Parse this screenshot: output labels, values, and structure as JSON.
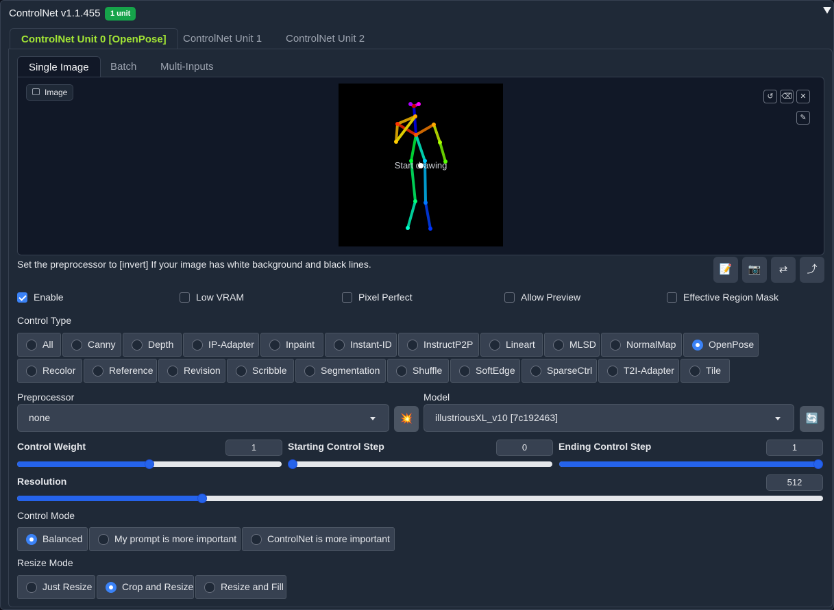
{
  "header": {
    "title": "ControlNet v1.1.455",
    "badge": "1 unit"
  },
  "unit_tabs": [
    "ControlNet Unit 0 [OpenPose]",
    "ControlNet Unit 1",
    "ControlNet Unit 2"
  ],
  "image_tabs": [
    "Single Image",
    "Batch",
    "Multi-Inputs"
  ],
  "canvas": {
    "image_label": "Image",
    "start_drawing": "Start drawing"
  },
  "hint": "Set the preprocessor to [invert] If your image has white background and black lines.",
  "action_buttons": {
    "edit": "📝",
    "camera": "📷",
    "swap": "⇄",
    "send": "⤴"
  },
  "checkboxes": [
    {
      "label": "Enable",
      "checked": true
    },
    {
      "label": "Low VRAM",
      "checked": false
    },
    {
      "label": "Pixel Perfect",
      "checked": false
    },
    {
      "label": "Allow Preview",
      "checked": false
    },
    {
      "label": "Effective Region Mask",
      "checked": false
    }
  ],
  "control_type": {
    "label": "Control Type",
    "row1": [
      "All",
      "Canny",
      "Depth",
      "IP-Adapter",
      "Inpaint",
      "Instant-ID",
      "InstructP2P",
      "Lineart",
      "MLSD",
      "NormalMap",
      "OpenPose"
    ],
    "row2": [
      "Recolor",
      "Reference",
      "Revision",
      "Scribble",
      "Segmentation",
      "Shuffle",
      "SoftEdge",
      "SparseCtrl",
      "T2I-Adapter",
      "Tile"
    ],
    "selected": "OpenPose"
  },
  "preprocessor": {
    "label": "Preprocessor",
    "value": "none",
    "run_icon": "💥"
  },
  "model": {
    "label": "Model",
    "value": "illustriousXL_v10 [7c192463]",
    "refresh_icon": "🔄"
  },
  "sliders": {
    "control_weight": {
      "label": "Control Weight",
      "value": "1",
      "fraction": 0.5
    },
    "starting_step": {
      "label": "Starting Control Step",
      "value": "0",
      "fraction": 0.0
    },
    "ending_step": {
      "label": "Ending Control Step",
      "value": "1",
      "fraction": 1.0
    },
    "resolution": {
      "label": "Resolution",
      "value": "512",
      "fraction": 0.23
    }
  },
  "control_mode": {
    "label": "Control Mode",
    "options": [
      "Balanced",
      "My prompt is more important",
      "ControlNet is more important"
    ],
    "selected": "Balanced"
  },
  "resize_mode": {
    "label": "Resize Mode",
    "options": [
      "Just Resize",
      "Crop and Resize",
      "Resize and Fill"
    ],
    "selected": "Crop and Resize"
  }
}
